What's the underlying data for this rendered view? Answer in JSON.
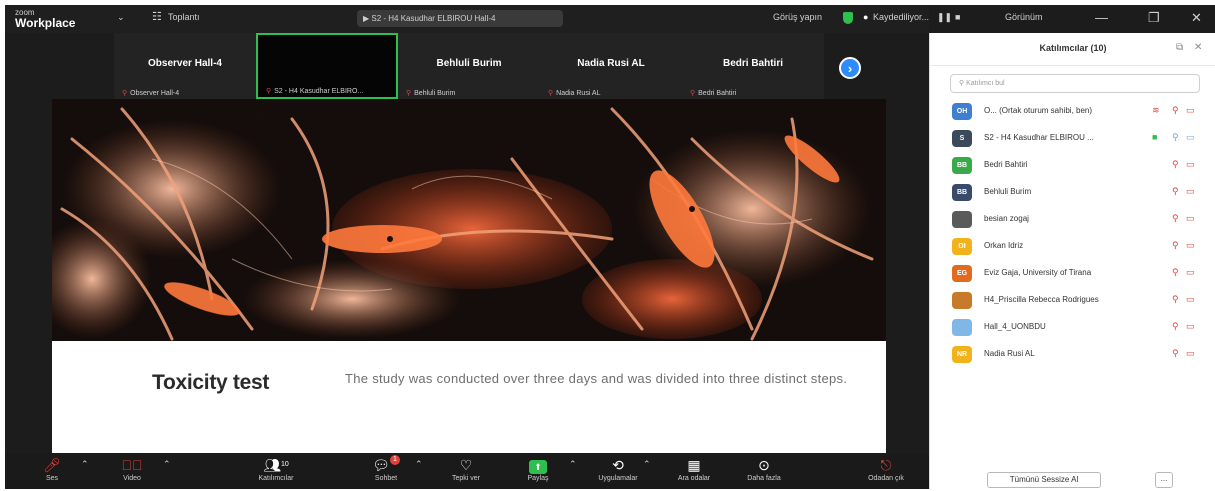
{
  "titlebar": {
    "logo_line1": "zoom",
    "logo_line2": "Workplace",
    "menu_caret": "⌄",
    "meetings_label": "Toplantı",
    "meeting_pill": "S2 - H4 Kasudhar ELBIROU Hall-4",
    "view_label": "Görüş yapın",
    "recording_label": "Kaydediliyor...",
    "view_mode_label": "Görünüm",
    "colors": {
      "shield": "#2fbf4f",
      "bar": "#1f1f1f"
    }
  },
  "thumbnails": [
    {
      "name": "Observer Hall-4",
      "sub": "Observer Hall-4",
      "active": false
    },
    {
      "name": "",
      "sub": "S2 - H4 Kasudhar ELBIRO...",
      "active": true
    },
    {
      "name": "Behluli Burim",
      "sub": "Behluli Burim",
      "active": false
    },
    {
      "name": "Nadia Rusi AL",
      "sub": "Nadia Rusi AL",
      "active": false
    },
    {
      "name": "Bedri Bahtiri",
      "sub": "Bedri Bahtiri",
      "active": false
    }
  ],
  "next_arrow": "›",
  "slide": {
    "title": "Toxicity test",
    "text": "The study was conducted over three days and was divided into three distinct steps."
  },
  "toolbar": {
    "items": [
      {
        "icon": "mic-muted-icon",
        "glyph": "🎤",
        "label": "Ses"
      },
      {
        "icon": "video-off-icon",
        "glyph": "🎥",
        "label": "Video"
      },
      {
        "icon": "participants-icon",
        "glyph": "👥",
        "label": "Katılımcılar",
        "count": "10"
      },
      {
        "icon": "chat-icon",
        "glyph": "💬",
        "label": "Sohbet",
        "badge": "1"
      },
      {
        "icon": "react-icon",
        "glyph": "♡",
        "label": "Tepki ver"
      },
      {
        "icon": "share-icon",
        "glyph": "⬆",
        "label": "Paylaş"
      },
      {
        "icon": "apps-icon",
        "glyph": "⚙",
        "label": "Uygulamalar"
      },
      {
        "icon": "tools-icon",
        "glyph": "▦",
        "label": "Ara odalar"
      },
      {
        "icon": "more-icon",
        "glyph": "⋯",
        "label": "Daha fazla"
      },
      {
        "icon": "leave-icon",
        "glyph": "⏻",
        "label": "Odadan çık"
      }
    ]
  },
  "panel": {
    "title": "Katılımcılar (10)",
    "search_placeholder": "Katılımcı bul",
    "participants": [
      {
        "initials": "OH",
        "color": "#3f7fd1",
        "name": "O... (Ortak oturum sahibi, ben)",
        "extra": "mic-on"
      },
      {
        "initials": "S",
        "color": "#3a4a5a",
        "name": "S2 - H4 Kasudhar ELBIROU ...",
        "extra": "screen-share"
      },
      {
        "initials": "BB",
        "color": "#39a94a",
        "name": "Bedri Bahtiri",
        "extra": ""
      },
      {
        "initials": "BB",
        "color": "#3a4a6a",
        "name": "Behluli Burim",
        "extra": ""
      },
      {
        "initials": "",
        "color": "#5a5a5a",
        "name": "besian zogaj",
        "extra": ""
      },
      {
        "initials": "OI",
        "color": "#f2b21c",
        "name": "Orkan Idriz",
        "extra": ""
      },
      {
        "initials": "EG",
        "color": "#e06b1e",
        "name": "Eviz Gaja, University of Tirana",
        "extra": ""
      },
      {
        "initials": "",
        "color": "#c77a2a",
        "name": "H4_Priscilla Rebecca Rodrigues",
        "extra": ""
      },
      {
        "initials": "",
        "color": "#7fb7e6",
        "name": "Hall_4_UONBDU",
        "extra": ""
      },
      {
        "initials": "NR",
        "color": "#f2b21c",
        "name": "Nadia Rusi AL",
        "extra": ""
      }
    ],
    "invite_label": "Tümünü Sessize Al",
    "more_label": "..."
  }
}
